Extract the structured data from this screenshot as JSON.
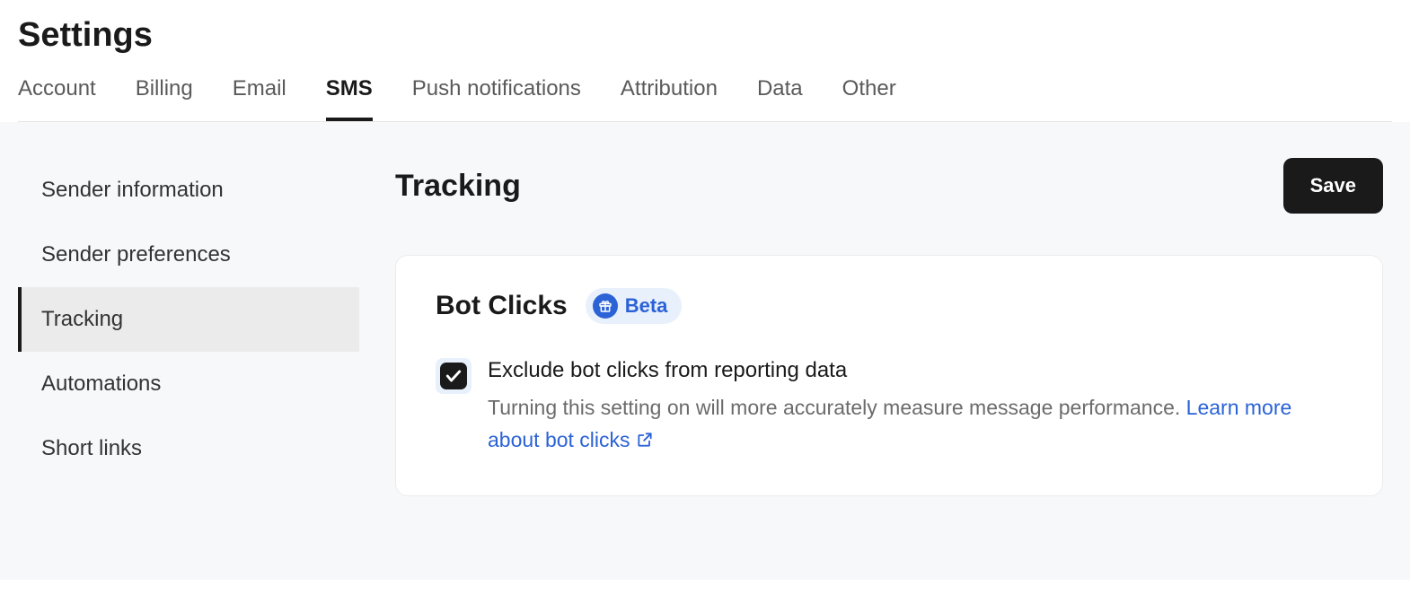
{
  "header": {
    "title": "Settings",
    "tabs": [
      {
        "label": "Account",
        "active": false
      },
      {
        "label": "Billing",
        "active": false
      },
      {
        "label": "Email",
        "active": false
      },
      {
        "label": "SMS",
        "active": true
      },
      {
        "label": "Push notifications",
        "active": false
      },
      {
        "label": "Attribution",
        "active": false
      },
      {
        "label": "Data",
        "active": false
      },
      {
        "label": "Other",
        "active": false
      }
    ]
  },
  "sidebar": {
    "items": [
      {
        "label": "Sender information",
        "active": false
      },
      {
        "label": "Sender preferences",
        "active": false
      },
      {
        "label": "Tracking",
        "active": true
      },
      {
        "label": "Automations",
        "active": false
      },
      {
        "label": "Short links",
        "active": false
      }
    ]
  },
  "main": {
    "section_title": "Tracking",
    "save_label": "Save",
    "card": {
      "title": "Bot Clicks",
      "badge_label": "Beta",
      "checkbox": {
        "checked": true,
        "label": "Exclude bot clicks from reporting data",
        "help_prefix": "Turning this setting on will more accurately measure message performance. ",
        "link_text": "Learn more about bot clicks"
      }
    }
  }
}
